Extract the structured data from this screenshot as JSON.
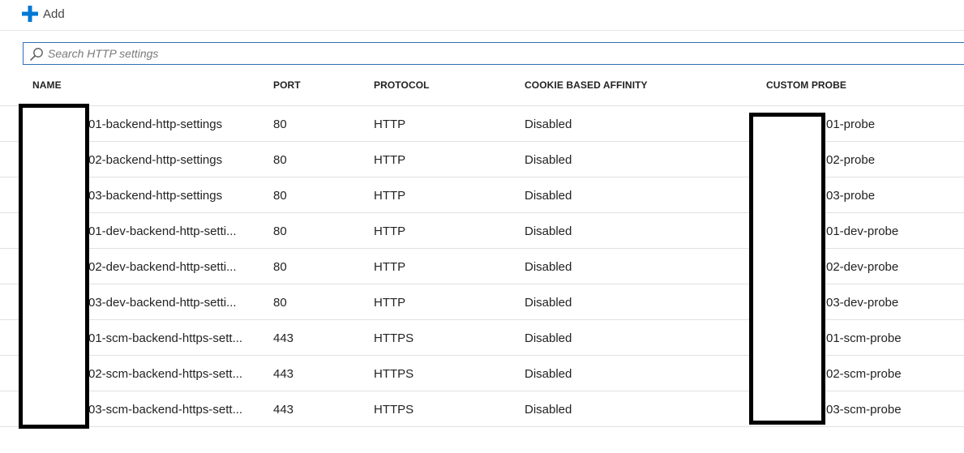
{
  "toolbar": {
    "add_label": "Add"
  },
  "search": {
    "placeholder": "Search HTTP settings"
  },
  "table": {
    "columns": [
      "NAME",
      "PORT",
      "PROTOCOL",
      "COOKIE BASED AFFINITY",
      "CUSTOM PROBE"
    ],
    "rows": [
      {
        "name": "01-backend-http-settings",
        "port": "80",
        "protocol": "HTTP",
        "affinity": "Disabled",
        "probe": "01-probe"
      },
      {
        "name": "02-backend-http-settings",
        "port": "80",
        "protocol": "HTTP",
        "affinity": "Disabled",
        "probe": "02-probe"
      },
      {
        "name": "03-backend-http-settings",
        "port": "80",
        "protocol": "HTTP",
        "affinity": "Disabled",
        "probe": "03-probe"
      },
      {
        "name": "01-dev-backend-http-setti...",
        "port": "80",
        "protocol": "HTTP",
        "affinity": "Disabled",
        "probe": "01-dev-probe"
      },
      {
        "name": "02-dev-backend-http-setti...",
        "port": "80",
        "protocol": "HTTP",
        "affinity": "Disabled",
        "probe": "02-dev-probe"
      },
      {
        "name": "03-dev-backend-http-setti...",
        "port": "80",
        "protocol": "HTTP",
        "affinity": "Disabled",
        "probe": "03-dev-probe"
      },
      {
        "name": "01-scm-backend-https-sett...",
        "port": "443",
        "protocol": "HTTPS",
        "affinity": "Disabled",
        "probe": "01-scm-probe"
      },
      {
        "name": "02-scm-backend-https-sett...",
        "port": "443",
        "protocol": "HTTPS",
        "affinity": "Disabled",
        "probe": "02-scm-probe"
      },
      {
        "name": "03-scm-backend-https-sett...",
        "port": "443",
        "protocol": "HTTPS",
        "affinity": "Disabled",
        "probe": "03-scm-probe"
      }
    ]
  },
  "icons": {
    "add": "plus-icon",
    "search": "search-icon"
  },
  "colors": {
    "accent": "#0078d4",
    "search_border": "#2f6fb5"
  }
}
